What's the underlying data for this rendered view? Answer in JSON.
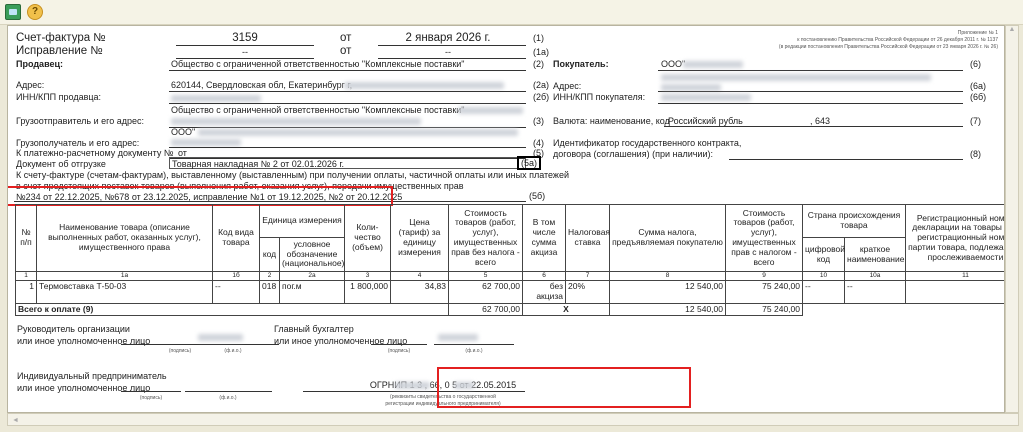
{
  "toolbar": {
    "icons": [
      "save-icon",
      "help-icon"
    ]
  },
  "header": {
    "invoice_label": "Счет-фактура №",
    "invoice_number": "3159",
    "ot": "от",
    "invoice_date": "2 января 2026 г.",
    "code1": "(1)",
    "correction_label": "Исправление №",
    "correction_number": "--",
    "correction_date": "--",
    "code1a": "(1а)",
    "appendix": [
      "Приложение № 1",
      "к постановлению Правительства Российской Федерации от 26 декабря 2011 г. № 1137",
      "(в редакции постановления Правительства Российской Федерации от 23 января 2026 г. № 26)"
    ]
  },
  "seller": {
    "label": "Продавец:",
    "name": "Общество с ограниченной ответственностью \"Комплексные поставки\"",
    "code": "(2)",
    "address_label": "Адрес:",
    "address": "620144, Свердловская обл, Екатеринбург г,",
    "address_code": "(2а)",
    "inn_label": "ИНН/КПП продавца:",
    "inn_code": "(2б)",
    "shipper_label": "Грузоотправитель и его адрес:",
    "shipper": "Общество с ограниченной ответственностью \"Комплексные поставки\"",
    "shipper_code": "(3)",
    "consignee_label": "Грузополучатель и его адрес:",
    "consignee": "ООО\"",
    "consignee_code": "(4)",
    "payment_doc_label": "К платежно-расчетному документу №",
    "payment_doc": "от",
    "payment_code": "(5)",
    "shipment_doc_label": "Документ об отгрузке",
    "shipment_doc": "Товарная накладная № 2 от 02.01.2026 г.",
    "shipment_code": "(5а)",
    "advance_text_1": "К счету-фактуре (счетам-фактурам), выставленному (выставленным) при получении оплаты, частичной оплаты или иных платежей",
    "advance_text_2": "в счет предстоящих поставок товаров (выполнения работ, оказания услуг), передачи имущественных прав",
    "advance_refs": "№234 от 22.12.2025, №678 от 23.12.2025, исправление №1 от 19.12.2025, №2 от 20.12.2025",
    "advance_code": "(5б)"
  },
  "buyer": {
    "label": "Покупатель:",
    "name": "ООО\"",
    "code": "(6)",
    "address_label": "Адрес:",
    "address_code": "(6а)",
    "inn_label": "ИНН/КПП покупателя:",
    "inn_code": "(6б)",
    "currency_label": "Валюта: наименование, код",
    "currency": "Российский рубль",
    "currency_code_value": ", 643",
    "currency_code": "(7)",
    "contract_label_1": "Идентификатор государственного контракта,",
    "contract_label_2": "договора (соглашения) (при наличии):",
    "contract_code": "(8)"
  },
  "table": {
    "headers": {
      "c1": "№ п/п",
      "c1a": "Наименование товара (описание выполненных работ, оказанных услуг), имущественного права",
      "c1b": "Код вида товара",
      "unit": "Единица измерения",
      "c2": "код",
      "c2a": "условное обозначение (национальное)",
      "c3": "Коли-чество (объем)",
      "c4": "Цена (тариф) за единицу измерения",
      "c5": "Стоимость товаров (работ, услуг), имущественных прав без налога - всего",
      "c6": "В том числе сумма акциза",
      "c7": "Налоговая ставка",
      "c8": "Сумма налога, предъявляемая покупателю",
      "c9": "Стоимость товаров (работ, услуг), имущественных прав с налогом - всего",
      "country": "Страна происхождения товара",
      "c10": "цифровой код",
      "c10a": "краткое наименование",
      "c11": "Регистрационный номер декларации на товары или регистрационный номер партии товара, подлежащего прослеживаемости"
    },
    "numbers": [
      "1",
      "1а",
      "1б",
      "2",
      "2а",
      "3",
      "4",
      "5",
      "6",
      "7",
      "8",
      "9",
      "10",
      "10а",
      "11"
    ],
    "rows": [
      {
        "n": "1",
        "name": "Термовставка Т-50-03",
        "kind": "--",
        "unit_code": "018",
        "unit": "пог.м",
        "qty": "1 800,000",
        "price": "34,83",
        "sum": "62 700,00",
        "excise": "без акциза",
        "rate": "20%",
        "tax": "12 540,00",
        "total": "75 240,00",
        "country_code": "--",
        "country_name": "--",
        "decl": ""
      }
    ],
    "total": {
      "label": "Всего к оплате (9)",
      "sum": "62 700,00",
      "excise": "X",
      "tax": "12 540,00",
      "total": "75 240,00"
    }
  },
  "signatures": {
    "head_label_1": "Руководитель организации",
    "head_label_2": "или иное уполномоченное лицо",
    "accountant_label_1": "Главный бухгалтер",
    "accountant_label_2": "или иное уполномоченное лицо",
    "ip_label_1": "Индивидуальный предприниматель",
    "ip_label_2": "или иное уполномоченное лицо",
    "sign": "(подпись)",
    "fio": "(ф.и.о.)",
    "ogrnip": "ОГРНИП 1          3  , 66, 0          5 от 22.05.2015",
    "ogrnip_caption_1": "(реквизиты свидетельства о государственной",
    "ogrnip_caption_2": "регистрации индивидуального предпринимателя)"
  }
}
